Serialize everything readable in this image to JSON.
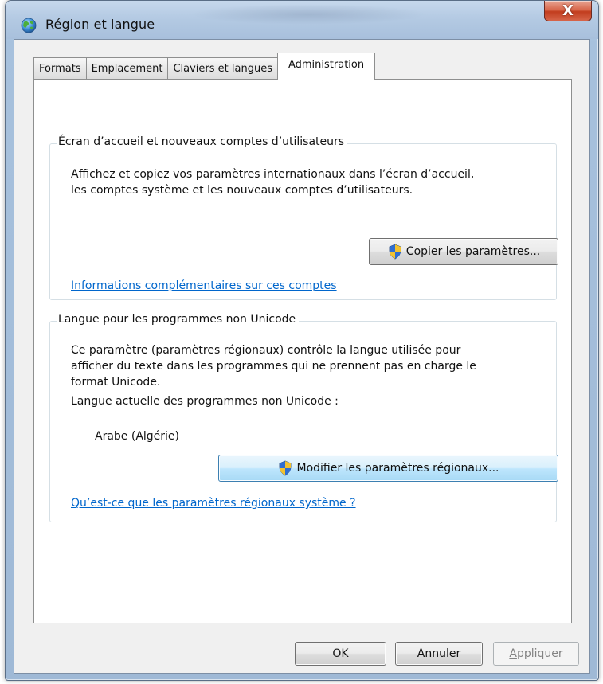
{
  "window": {
    "title": "Région et langue",
    "close_label": "X"
  },
  "tabs": [
    {
      "label": "Formats",
      "active": false
    },
    {
      "label": "Emplacement",
      "active": false
    },
    {
      "label": "Claviers et langues",
      "active": false
    },
    {
      "label": "Administration",
      "active": true
    }
  ],
  "welcome_group": {
    "title": "Écran d’accueil et nouveaux comptes d’utilisateurs",
    "line1": "Affichez et copiez vos paramètres internationaux dans l’écran d’accueil,",
    "line2": "les comptes système et les nouveaux comptes d’utilisateurs.",
    "copy_button": {
      "mnemonic": "C",
      "rest": "opier les paramètres..."
    },
    "link": "Informations complémentaires sur ces comptes"
  },
  "unicode_group": {
    "title": "Langue pour les programmes non Unicode",
    "line1": "Ce paramètre (paramètres régionaux) contrôle la langue utilisée pour",
    "line2": "afficher du texte dans les programmes qui ne prennent pas en charge le",
    "line3": "format Unicode.",
    "current_label": "Langue actuelle des programmes non Unicode :",
    "current_value": "Arabe (Algérie)",
    "change_button": "Modifier les paramètres régionaux...",
    "link": "Qu’est-ce que les paramètres régionaux système ?"
  },
  "footer": {
    "ok": "OK",
    "cancel": "Annuler",
    "apply_mnemonic": "A",
    "apply_rest": "ppliquer"
  },
  "colors": {
    "link": "#0066cc",
    "close_button": "#c23d1e",
    "focus_border": "#3c7fb1"
  },
  "icons": {
    "title": "globe-icon",
    "buttons": "uac-shield-icon"
  }
}
